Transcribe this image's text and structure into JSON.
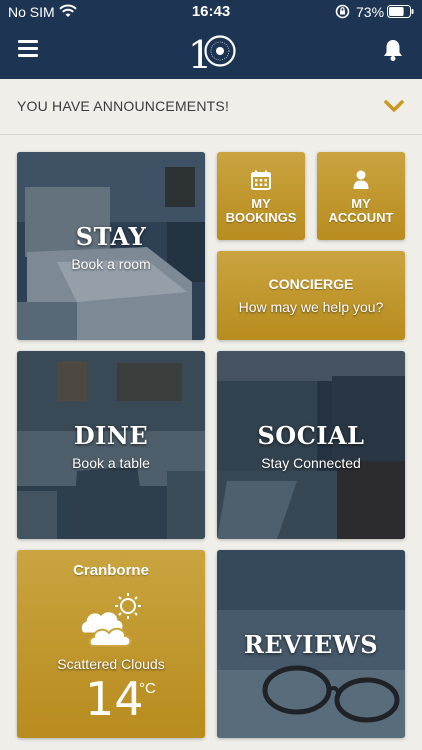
{
  "status_bar": {
    "carrier": "No SIM",
    "time": "16:43",
    "battery_percent": "73%",
    "battery_level": 0.73
  },
  "header": {
    "logo_text": "10",
    "menu_icon": "hamburger-icon",
    "notification_icon": "bell-icon",
    "background": "#1d3553"
  },
  "announcements": {
    "label": "YOU HAVE ANNOUNCEMENTS!",
    "chevron_icon": "chevron-down-icon",
    "accent": "#c79a1e"
  },
  "tiles": {
    "stay": {
      "title": "STAY",
      "subtitle": "Book a room"
    },
    "my_bookings": {
      "label_line1": "MY",
      "label_line2": "BOOKINGS",
      "icon": "calendar-icon"
    },
    "my_account": {
      "label_line1": "MY",
      "label_line2": "ACCOUNT",
      "icon": "user-icon"
    },
    "concierge": {
      "title": "CONCIERGE",
      "subtitle": "How may we help you?"
    },
    "dine": {
      "title": "DINE",
      "subtitle": "Book a table"
    },
    "social": {
      "title": "SOCIAL",
      "subtitle": "Stay Connected"
    },
    "weather": {
      "location": "Cranborne",
      "condition": "Scattered Clouds",
      "temperature": "14",
      "unit": "°C",
      "icon": "scattered-clouds-icon"
    },
    "reviews": {
      "title": "REVIEWS"
    }
  },
  "colors": {
    "gold_top": "#c9a43f",
    "gold_bottom": "#b88c1e",
    "page_bg": "#efeee9"
  }
}
